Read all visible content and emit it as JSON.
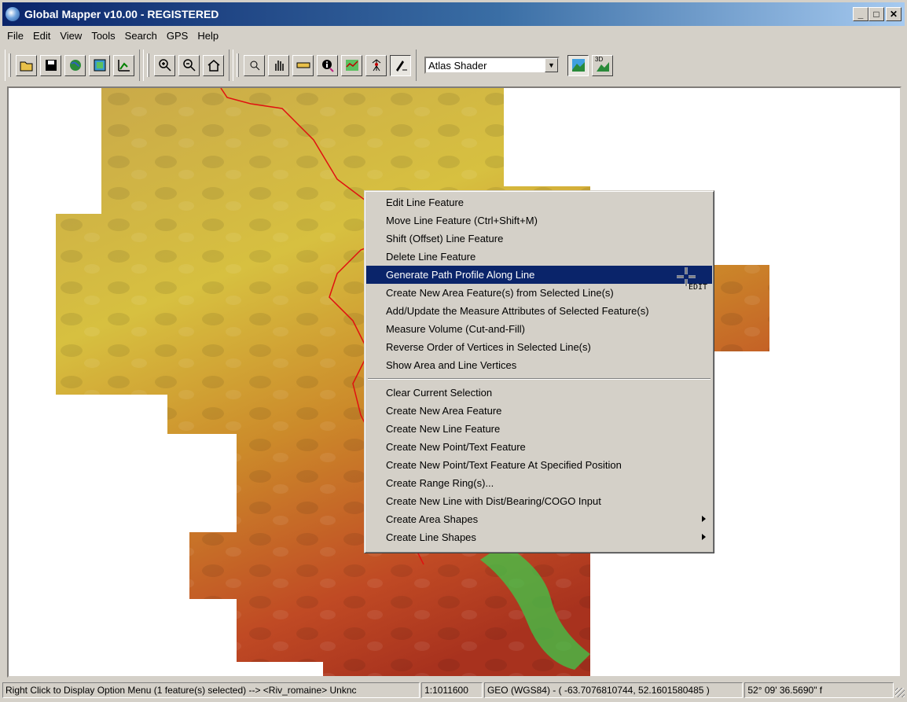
{
  "window": {
    "title": "Global Mapper v10.00 - REGISTERED",
    "min_label": "_",
    "max_label": "□",
    "close_label": "✕"
  },
  "menubar": [
    "File",
    "Edit",
    "View",
    "Tools",
    "Search",
    "GPS",
    "Help"
  ],
  "toolbar": {
    "shader": {
      "selected": "Atlas Shader",
      "arrow": "▼"
    },
    "icons": [
      "open-folder-icon",
      "save-icon",
      "globe-icon",
      "config-icon",
      "digitizer-icon",
      "zoom-in-icon",
      "zoom-out-icon",
      "home-icon",
      "zoom-tool-icon",
      "pan-tool-icon",
      "measure-tool-icon",
      "info-tool-icon",
      "path-profile-icon",
      "view-shed-icon",
      "digitizer-edit-icon",
      "shaded-relief-icon",
      "3d-view-icon"
    ],
    "label_3d": "3D"
  },
  "context_menu": {
    "group1": [
      "Edit Line Feature",
      "Move Line Feature (Ctrl+Shift+M)",
      "Shift (Offset) Line Feature",
      "Delete Line Feature",
      "Generate Path Profile Along Line",
      "Create New Area Feature(s) from Selected Line(s)",
      "Add/Update the Measure Attributes of Selected Feature(s)",
      "Measure Volume (Cut-and-Fill)",
      "Reverse Order of Vertices in Selected Line(s)",
      "Show Area and Line Vertices"
    ],
    "group2": [
      "Clear Current Selection",
      "Create New Area Feature",
      "Create New Line Feature",
      "Create New Point/Text Feature",
      "Create New Point/Text Feature At Specified Position",
      "Create Range Ring(s)...",
      "Create New Line with Dist/Bearing/COGO Input"
    ],
    "submenus": [
      "Create Area Shapes",
      "Create Line Shapes"
    ],
    "highlighted_index": 4
  },
  "cursor_label": "EDIT",
  "status": {
    "message": "Right Click to Display Option Menu (1 feature(s) selected) --> <Riv_romaine> Unknc",
    "scale": "1:1011600",
    "coords": "GEO (WGS84) - ( -63.7076810744, 52.1601580485 )",
    "dms": "52° 09' 36.5690\" f"
  },
  "colors": {
    "title_start": "#0a246a",
    "title_end": "#a6caf0",
    "highlight": "#0a246a",
    "river": "#e01010"
  }
}
